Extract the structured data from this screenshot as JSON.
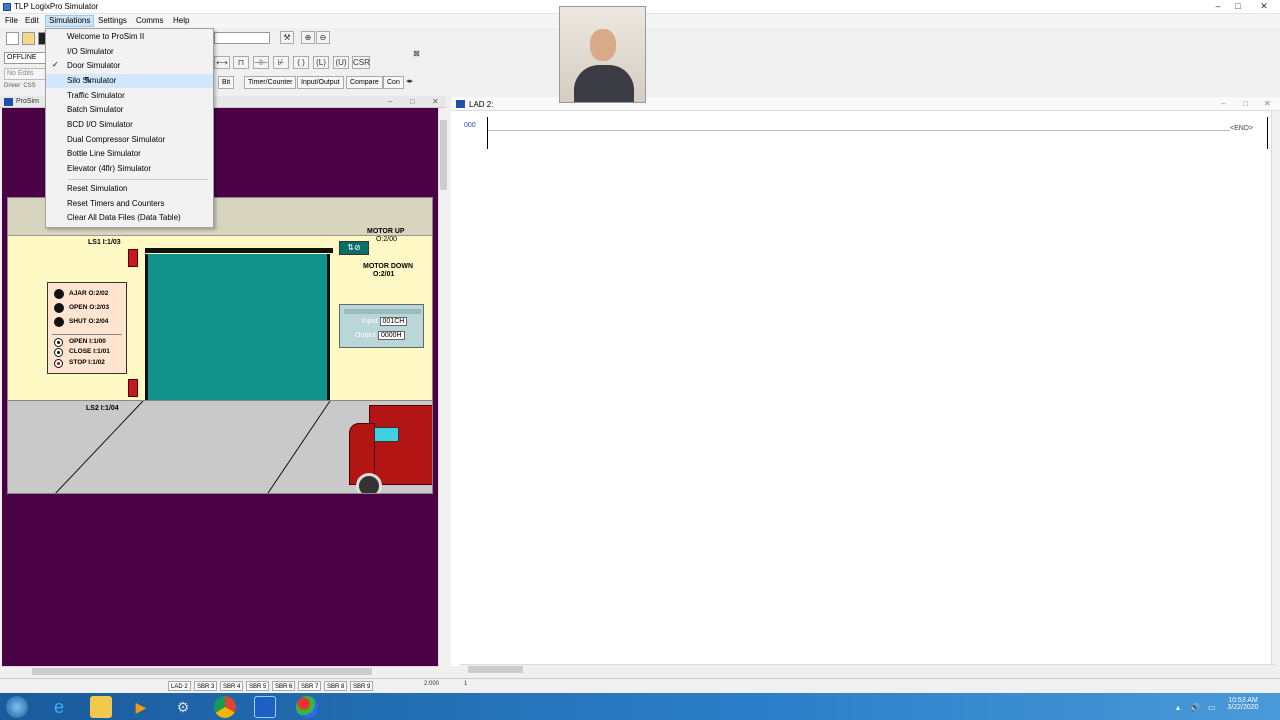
{
  "window": {
    "title": "TLP LogixPro Simulator"
  },
  "menu": [
    "File",
    "Edit",
    "Simulations",
    "Settings",
    "Comms",
    "Help"
  ],
  "toolbar": {
    "mode": "OFFLINE",
    "edits": "No Edits",
    "driver": "Driver: CSS",
    "csr": "CSR",
    "tabs": [
      "Bit",
      "Timer/Counter",
      "Input/Output",
      "Compare",
      "Con"
    ]
  },
  "prosim": {
    "title": "ProSim"
  },
  "dropdown": {
    "items": [
      "Welcome to ProSim II",
      "I/O Simulator",
      "Door Simulator",
      "Silo Simulator",
      "Traffic Simulator",
      "Batch Simulator",
      "BCD I/O Simulator",
      "Dual Compressor Simulator",
      "Bottle Line Simulator",
      "Elevator (4flr) Simulator",
      "Reset Simulation",
      "Reset Timers and Counters",
      "Clear All Data Files (Data Table)"
    ],
    "check_mark": "✓"
  },
  "door": {
    "ls1": "LS1  I:1/03",
    "ls2": "LS2  I:1/04",
    "motor_up": "MOTOR UP",
    "motor_up_addr": "O:2/00",
    "motor_down": "MOTOR DOWN",
    "motor_down_addr": "O:2/01",
    "lamps": [
      "AJAR  O:2/02",
      "OPEN  O:2/03",
      "SHUT  O:2/04"
    ],
    "buttons": [
      "OPEN    I:1/00",
      "CLOSE I:1/01",
      "STOP   I:1/02"
    ],
    "input_label": "Input",
    "input_value": "001CH",
    "output_label": "Output",
    "output_value": "0000H"
  },
  "lad": {
    "title": "LAD 2:",
    "rung": "000",
    "end": "END"
  },
  "status": {
    "tabs": [
      "LAD 2",
      "SBR 3",
      "SBR 4",
      "SBR 5",
      "SBR 6",
      "SBR 7",
      "SBR 8",
      "SBR 9"
    ],
    "field": "2:000",
    "rung": "1"
  },
  "clock": {
    "time": "10:53 AM",
    "date": "3/22/2020"
  },
  "colors": {
    "workspace": "#4a0045",
    "door": "#12948c",
    "truck": "#b31414",
    "taskbar": "#2b7fc8"
  }
}
